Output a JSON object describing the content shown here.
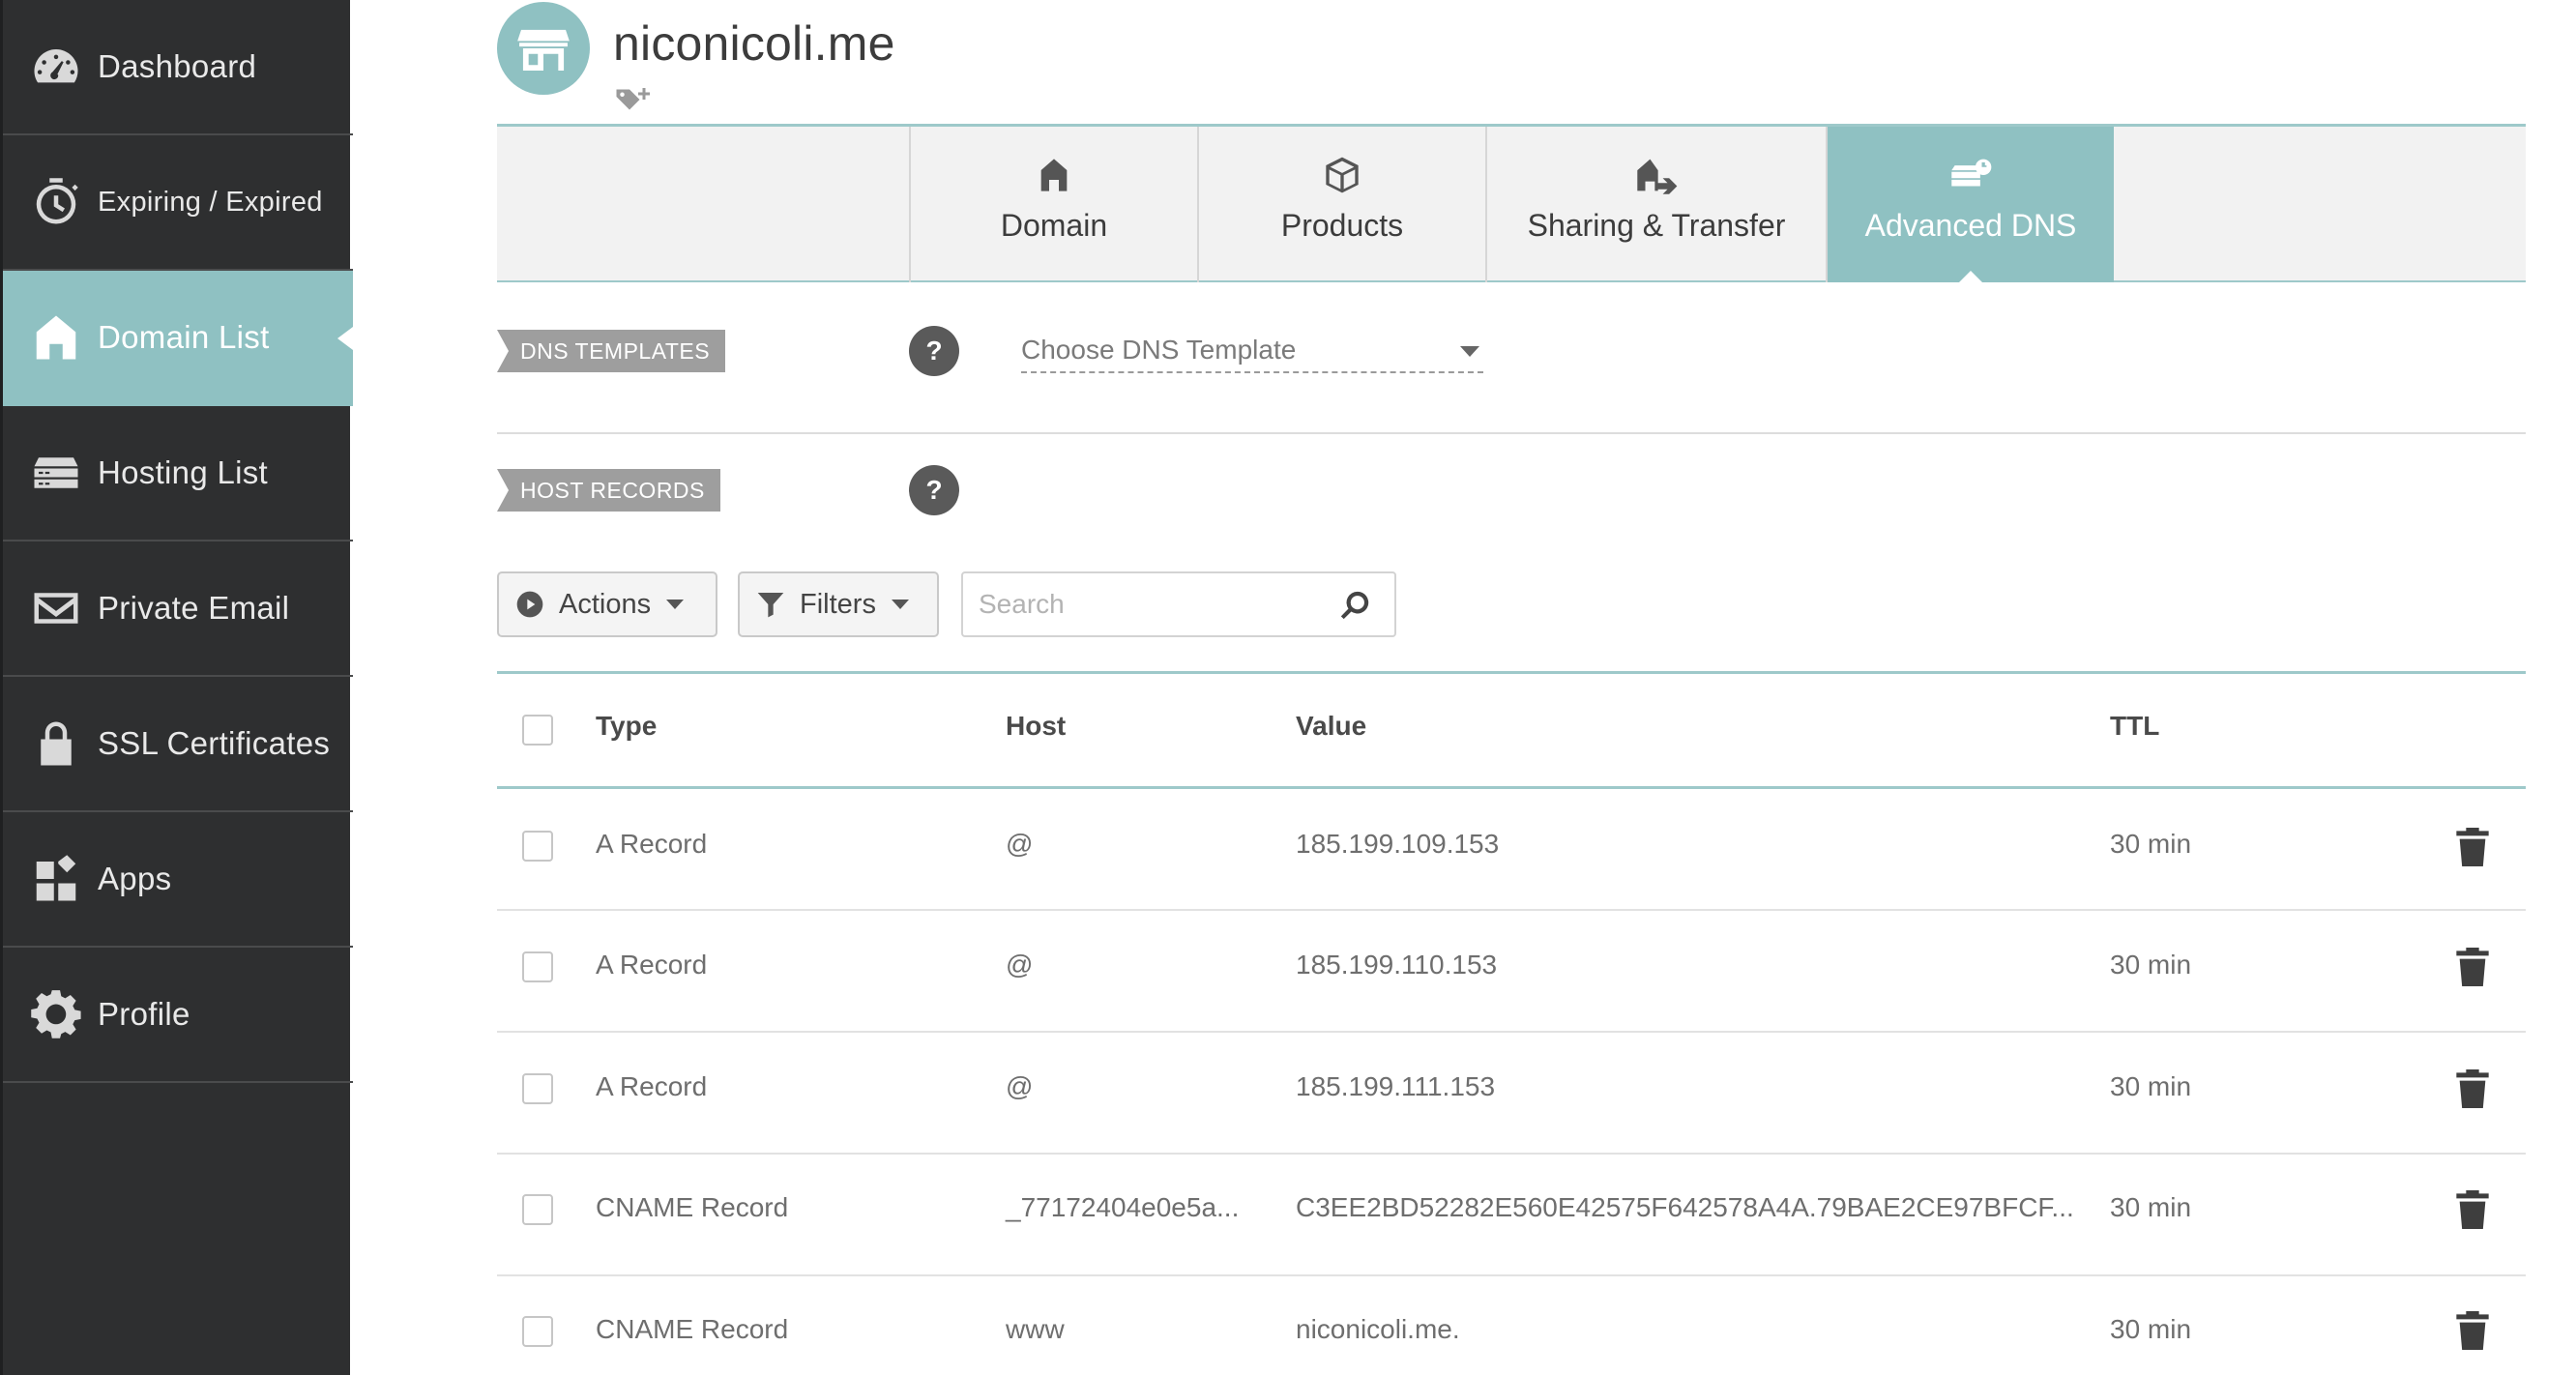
{
  "sidebar": {
    "items": [
      {
        "label": "Dashboard",
        "icon": "dashboard-gauge-icon"
      },
      {
        "label": "Expiring / Expired",
        "icon": "timer-icon"
      },
      {
        "label": "Domain List",
        "icon": "house-icon",
        "active": true
      },
      {
        "label": "Hosting List",
        "icon": "server-icon"
      },
      {
        "label": "Private Email",
        "icon": "envelope-icon"
      },
      {
        "label": "SSL Certificates",
        "icon": "lock-icon"
      },
      {
        "label": "Apps",
        "icon": "apps-grid-icon"
      },
      {
        "label": "Profile",
        "icon": "gear-icon"
      }
    ]
  },
  "header": {
    "domain": "niconicoli.me",
    "avatar_icon": "storefront-icon",
    "tag_icon": "add-tag-icon"
  },
  "tabs": [
    {
      "label": "Domain",
      "icon": "house-icon"
    },
    {
      "label": "Products",
      "icon": "box-icon"
    },
    {
      "label": "Sharing & Transfer",
      "icon": "house-transfer-icon"
    },
    {
      "label": "Advanced DNS",
      "icon": "server-settings-icon",
      "active": true
    }
  ],
  "dns_templates": {
    "label": "DNS TEMPLATES",
    "help": "?",
    "select_placeholder": "Choose DNS Template"
  },
  "host_records": {
    "label": "HOST RECORDS",
    "help": "?"
  },
  "toolbar": {
    "actions_label": "Actions",
    "filters_label": "Filters",
    "search_placeholder": "Search"
  },
  "table": {
    "columns": [
      "Type",
      "Host",
      "Value",
      "TTL"
    ],
    "rows": [
      {
        "type": "A Record",
        "host": "@",
        "value": "185.199.109.153",
        "ttl": "30 min"
      },
      {
        "type": "A Record",
        "host": "@",
        "value": "185.199.110.153",
        "ttl": "30 min"
      },
      {
        "type": "A Record",
        "host": "@",
        "value": "185.199.111.153",
        "ttl": "30 min"
      },
      {
        "type": "CNAME Record",
        "host": "_77172404e0e5a...",
        "value": "C3EE2BD52282E560E42575F642578A4A.79BAE2CE97BFCF...",
        "ttl": "30 min"
      },
      {
        "type": "CNAME Record",
        "host": "www",
        "value": "niconicoli.me.",
        "ttl": "30 min"
      }
    ]
  },
  "colors": {
    "accent": "#8fc1c2",
    "sidebar_bg": "#2e2f30",
    "ribbon": "#9e9e9e"
  }
}
